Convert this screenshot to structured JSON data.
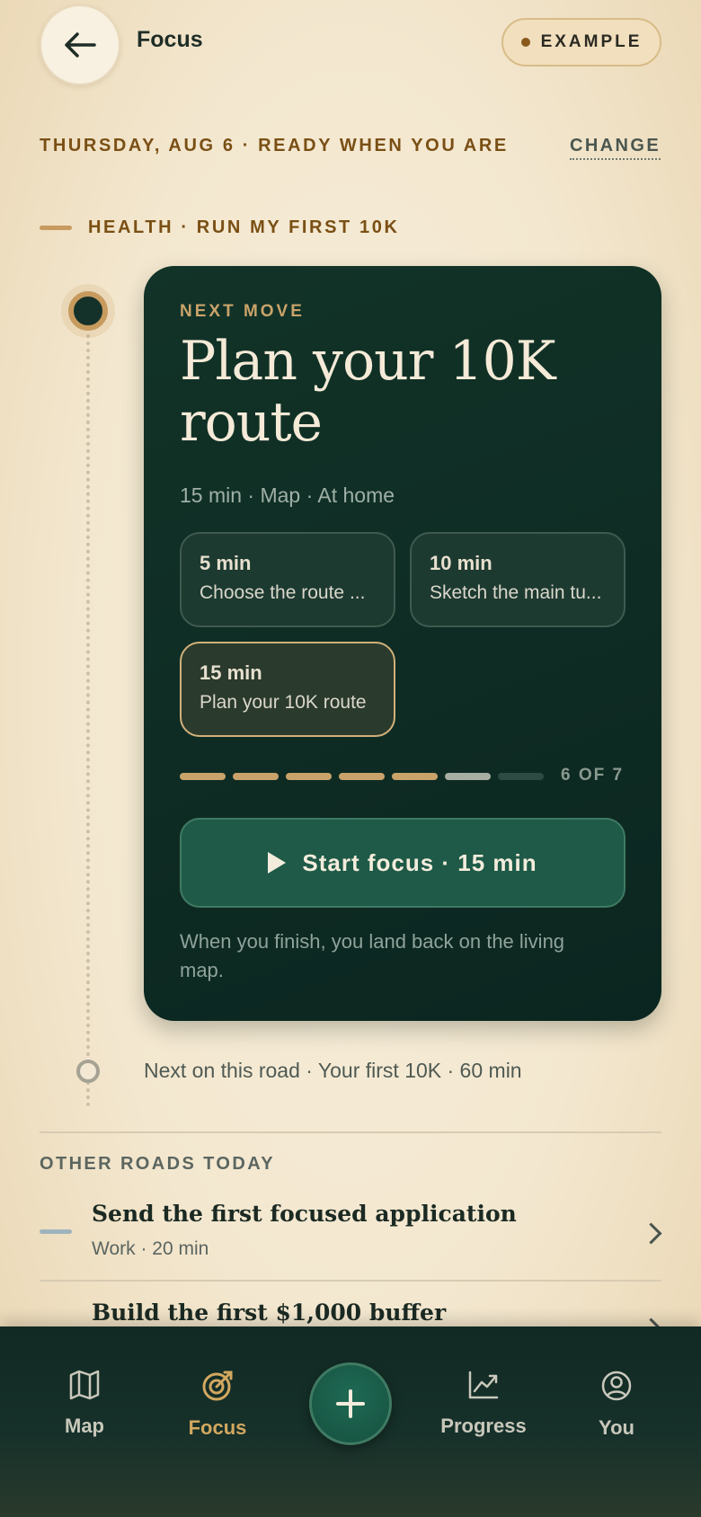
{
  "header": {
    "title": "Focus",
    "example_label": "EXAMPLE"
  },
  "date_line": "THURSDAY, AUG 6 · READY WHEN YOU ARE",
  "change_label": "CHANGE",
  "goal_label": "HEALTH · RUN MY FIRST 10K",
  "card": {
    "eyebrow": "NEXT MOVE",
    "title": "Plan your 10K route",
    "meta": "15 min · Map · At home",
    "options": [
      {
        "duration": "5 min",
        "name": "Choose the route ..."
      },
      {
        "duration": "10 min",
        "name": "Sketch the main tu..."
      },
      {
        "duration": "15 min",
        "name": "Plan your 10K route",
        "selected": true
      }
    ],
    "progress": {
      "label": "6 OF 7",
      "current": 6,
      "total": 7
    },
    "start_label": "Start focus · 15 min",
    "finish_note": "When you finish, you land back on the living map."
  },
  "next_on_road": "Next on this road · Your first 10K · 60 min",
  "other_roads": {
    "heading": "OTHER ROADS TODAY",
    "items": [
      {
        "title": "Send the first focused application",
        "meta": "Work · 20 min"
      },
      {
        "title": "Build the first $1,000 buffer",
        "meta": ""
      }
    ]
  },
  "nav": {
    "items": [
      {
        "label": "Map",
        "icon": "map-icon"
      },
      {
        "label": "Focus",
        "icon": "target-icon",
        "active": true
      },
      {
        "label": "Progress",
        "icon": "chart-icon"
      },
      {
        "label": "You",
        "icon": "user-icon"
      }
    ],
    "add_icon": "plus-icon"
  },
  "colors": {
    "card_bg": "#123328",
    "accent_gold": "#c79a5e",
    "button_green": "#1e5a47",
    "page_bg": "#f3e7cf"
  }
}
